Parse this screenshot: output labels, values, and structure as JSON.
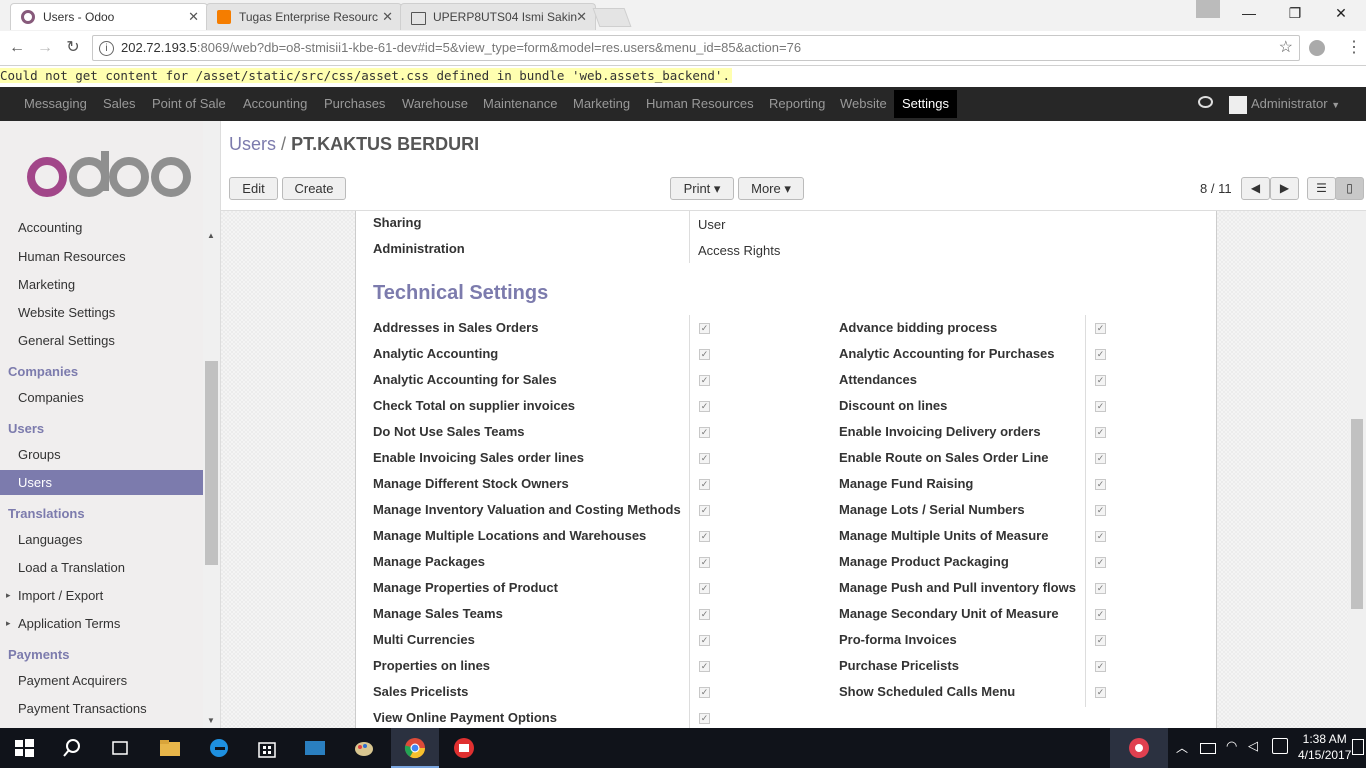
{
  "browser": {
    "tabs": [
      {
        "title": "Users - Odoo",
        "fav_color": "#875A7B"
      },
      {
        "title": "Tugas Enterprise Resourc",
        "fav_color": "#f57d00"
      },
      {
        "title": "UPERP8UTS04 Ismi Sakin",
        "fav_color": "#555555"
      }
    ],
    "url_host": "202.72.193.5",
    "url_rest": ":8069/web?db=o8-stmisii1-kbe-61-dev#id=5&view_type=form&model=res.users&menu_id=85&action=76"
  },
  "error_message": "Could not get content for /asset/static/src/css/asset.css defined in bundle 'web.assets_backend'.",
  "top_menu": {
    "items": [
      "Messaging",
      "Sales",
      "Point of Sale",
      "Accounting",
      "Purchases",
      "Warehouse",
      "Maintenance",
      "Marketing",
      "Human Resources",
      "Reporting",
      "Website",
      "Settings"
    ],
    "user": "Administrator"
  },
  "sidebar": {
    "logo_text": "odoo",
    "partial_item": "Accounting",
    "items_top": [
      "Human Resources",
      "Marketing",
      "Website Settings",
      "General Settings"
    ],
    "companies_head": "Companies",
    "companies_items": [
      "Companies"
    ],
    "users_head": "Users",
    "groups": "Groups",
    "users_active": "Users",
    "translations_head": "Translations",
    "translations_items": [
      "Languages",
      "Load a Translation"
    ],
    "import_export": "Import / Export",
    "application_terms": "Application Terms",
    "payments_head": "Payments",
    "payments_items": [
      "Payment Acquirers",
      "Payment Transactions"
    ]
  },
  "control_panel": {
    "breadcrumb_parent": "Users",
    "breadcrumb_sep": "/",
    "breadcrumb_current": "PT.KAKTUS BERDURI",
    "edit": "Edit",
    "create": "Create",
    "print": "Print ▾",
    "more": "More ▾",
    "pager": "8 / 11"
  },
  "form": {
    "sharing_label": "Sharing",
    "sharing_value": "User",
    "admin_label": "Administration",
    "admin_value": "Access Rights",
    "section_title": "Technical Settings",
    "left_settings": [
      "Addresses in Sales Orders",
      "Analytic Accounting",
      "Analytic Accounting for Sales",
      "Check Total on supplier invoices",
      "Do Not Use Sales Teams",
      "Enable Invoicing Sales order lines",
      "Manage Different Stock Owners",
      "Manage Inventory Valuation and Costing Methods",
      "Manage Multiple Locations and Warehouses",
      "Manage Packages",
      "Manage Properties of Product",
      "Manage Sales Teams",
      "Multi Currencies",
      "Properties on lines",
      "Sales Pricelists",
      "View Online Payment Options"
    ],
    "right_settings": [
      "Advance bidding process",
      "Analytic Accounting for Purchases",
      "Attendances",
      "Discount on lines",
      "Enable Invoicing Delivery orders",
      "Enable Route on Sales Order Line",
      "Manage Fund Raising",
      "Manage Lots / Serial Numbers",
      "Manage Multiple Units of Measure",
      "Manage Product Packaging",
      "Manage Push and Pull inventory flows",
      "Manage Secondary Unit of Measure",
      "Pro-forma Invoices",
      "Purchase Pricelists",
      "Show Scheduled Calls Menu"
    ]
  },
  "taskbar": {
    "time": "1:38 AM",
    "date": "4/15/2017"
  },
  "colors": {
    "accent": "#7c7bad",
    "topbar": "#272727"
  }
}
